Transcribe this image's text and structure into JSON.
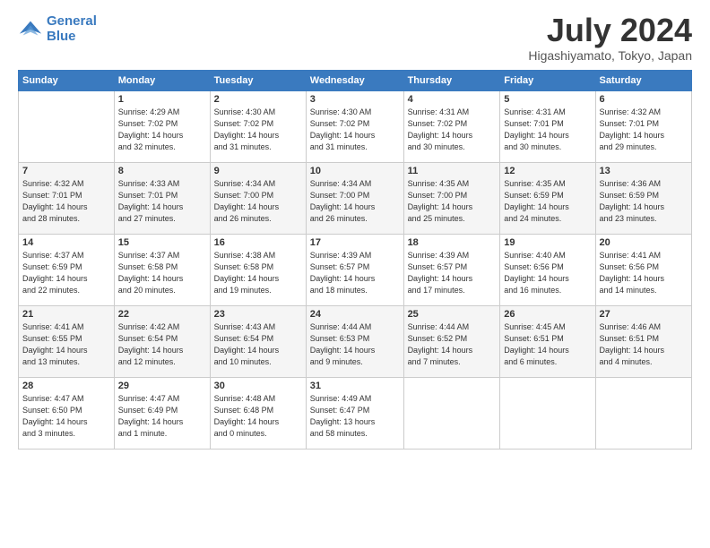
{
  "logo": {
    "line1": "General",
    "line2": "Blue"
  },
  "header": {
    "title": "July 2024",
    "location": "Higashiyamato, Tokyo, Japan"
  },
  "weekdays": [
    "Sunday",
    "Monday",
    "Tuesday",
    "Wednesday",
    "Thursday",
    "Friday",
    "Saturday"
  ],
  "weeks": [
    [
      {
        "day": "",
        "info": ""
      },
      {
        "day": "1",
        "info": "Sunrise: 4:29 AM\nSunset: 7:02 PM\nDaylight: 14 hours\nand 32 minutes."
      },
      {
        "day": "2",
        "info": "Sunrise: 4:30 AM\nSunset: 7:02 PM\nDaylight: 14 hours\nand 31 minutes."
      },
      {
        "day": "3",
        "info": "Sunrise: 4:30 AM\nSunset: 7:02 PM\nDaylight: 14 hours\nand 31 minutes."
      },
      {
        "day": "4",
        "info": "Sunrise: 4:31 AM\nSunset: 7:02 PM\nDaylight: 14 hours\nand 30 minutes."
      },
      {
        "day": "5",
        "info": "Sunrise: 4:31 AM\nSunset: 7:01 PM\nDaylight: 14 hours\nand 30 minutes."
      },
      {
        "day": "6",
        "info": "Sunrise: 4:32 AM\nSunset: 7:01 PM\nDaylight: 14 hours\nand 29 minutes."
      }
    ],
    [
      {
        "day": "7",
        "info": "Sunrise: 4:32 AM\nSunset: 7:01 PM\nDaylight: 14 hours\nand 28 minutes."
      },
      {
        "day": "8",
        "info": "Sunrise: 4:33 AM\nSunset: 7:01 PM\nDaylight: 14 hours\nand 27 minutes."
      },
      {
        "day": "9",
        "info": "Sunrise: 4:34 AM\nSunset: 7:00 PM\nDaylight: 14 hours\nand 26 minutes."
      },
      {
        "day": "10",
        "info": "Sunrise: 4:34 AM\nSunset: 7:00 PM\nDaylight: 14 hours\nand 26 minutes."
      },
      {
        "day": "11",
        "info": "Sunrise: 4:35 AM\nSunset: 7:00 PM\nDaylight: 14 hours\nand 25 minutes."
      },
      {
        "day": "12",
        "info": "Sunrise: 4:35 AM\nSunset: 6:59 PM\nDaylight: 14 hours\nand 24 minutes."
      },
      {
        "day": "13",
        "info": "Sunrise: 4:36 AM\nSunset: 6:59 PM\nDaylight: 14 hours\nand 23 minutes."
      }
    ],
    [
      {
        "day": "14",
        "info": "Sunrise: 4:37 AM\nSunset: 6:59 PM\nDaylight: 14 hours\nand 22 minutes."
      },
      {
        "day": "15",
        "info": "Sunrise: 4:37 AM\nSunset: 6:58 PM\nDaylight: 14 hours\nand 20 minutes."
      },
      {
        "day": "16",
        "info": "Sunrise: 4:38 AM\nSunset: 6:58 PM\nDaylight: 14 hours\nand 19 minutes."
      },
      {
        "day": "17",
        "info": "Sunrise: 4:39 AM\nSunset: 6:57 PM\nDaylight: 14 hours\nand 18 minutes."
      },
      {
        "day": "18",
        "info": "Sunrise: 4:39 AM\nSunset: 6:57 PM\nDaylight: 14 hours\nand 17 minutes."
      },
      {
        "day": "19",
        "info": "Sunrise: 4:40 AM\nSunset: 6:56 PM\nDaylight: 14 hours\nand 16 minutes."
      },
      {
        "day": "20",
        "info": "Sunrise: 4:41 AM\nSunset: 6:56 PM\nDaylight: 14 hours\nand 14 minutes."
      }
    ],
    [
      {
        "day": "21",
        "info": "Sunrise: 4:41 AM\nSunset: 6:55 PM\nDaylight: 14 hours\nand 13 minutes."
      },
      {
        "day": "22",
        "info": "Sunrise: 4:42 AM\nSunset: 6:54 PM\nDaylight: 14 hours\nand 12 minutes."
      },
      {
        "day": "23",
        "info": "Sunrise: 4:43 AM\nSunset: 6:54 PM\nDaylight: 14 hours\nand 10 minutes."
      },
      {
        "day": "24",
        "info": "Sunrise: 4:44 AM\nSunset: 6:53 PM\nDaylight: 14 hours\nand 9 minutes."
      },
      {
        "day": "25",
        "info": "Sunrise: 4:44 AM\nSunset: 6:52 PM\nDaylight: 14 hours\nand 7 minutes."
      },
      {
        "day": "26",
        "info": "Sunrise: 4:45 AM\nSunset: 6:51 PM\nDaylight: 14 hours\nand 6 minutes."
      },
      {
        "day": "27",
        "info": "Sunrise: 4:46 AM\nSunset: 6:51 PM\nDaylight: 14 hours\nand 4 minutes."
      }
    ],
    [
      {
        "day": "28",
        "info": "Sunrise: 4:47 AM\nSunset: 6:50 PM\nDaylight: 14 hours\nand 3 minutes."
      },
      {
        "day": "29",
        "info": "Sunrise: 4:47 AM\nSunset: 6:49 PM\nDaylight: 14 hours\nand 1 minute."
      },
      {
        "day": "30",
        "info": "Sunrise: 4:48 AM\nSunset: 6:48 PM\nDaylight: 14 hours\nand 0 minutes."
      },
      {
        "day": "31",
        "info": "Sunrise: 4:49 AM\nSunset: 6:47 PM\nDaylight: 13 hours\nand 58 minutes."
      },
      {
        "day": "",
        "info": ""
      },
      {
        "day": "",
        "info": ""
      },
      {
        "day": "",
        "info": ""
      }
    ]
  ]
}
